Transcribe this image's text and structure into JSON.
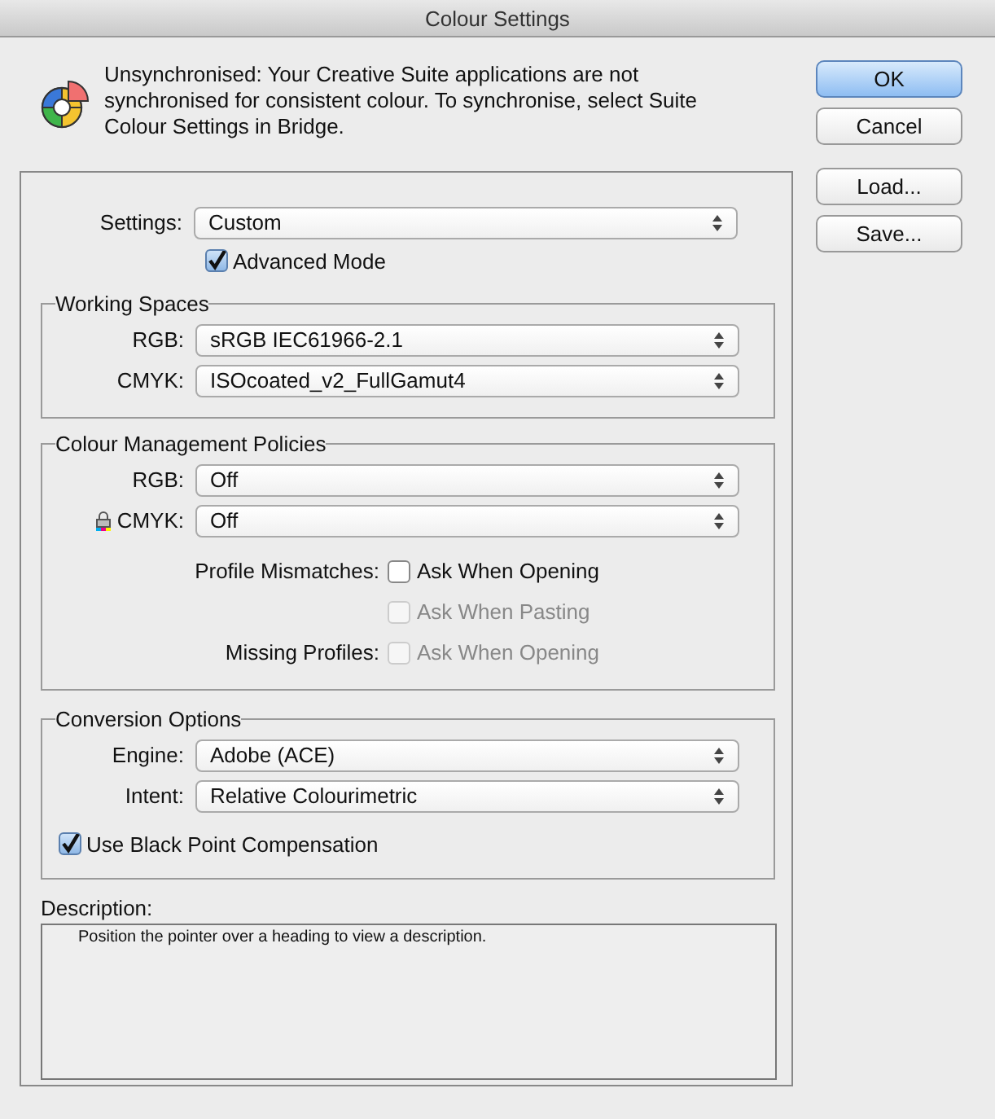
{
  "window": {
    "title": "Colour Settings"
  },
  "message": "Unsynchronised: Your Creative Suite applications are not synchronised for consistent colour. To synchronise, select Suite Colour Settings in Bridge.",
  "settings": {
    "label": "Settings:",
    "value": "Custom"
  },
  "advanced_mode": {
    "label": "Advanced Mode",
    "checked": true
  },
  "working_spaces": {
    "title": "Working Spaces",
    "rows": [
      {
        "label": "RGB:",
        "value": "sRGB IEC61966-2.1",
        "locked": false
      },
      {
        "label": "CMYK:",
        "value": "ISOcoated_v2_FullGamut4",
        "locked": false
      }
    ]
  },
  "policies": {
    "title": "Colour Management Policies",
    "rows": [
      {
        "label": "RGB:",
        "value": "Off",
        "locked": false
      },
      {
        "label": "CMYK:",
        "value": "Off",
        "locked": true
      }
    ],
    "options": [
      {
        "group_label": "Profile Mismatches:",
        "label": "Ask When Opening",
        "checked": false,
        "disabled": false
      },
      {
        "label": "Ask When Pasting",
        "checked": false,
        "disabled": true
      },
      {
        "group_label": "Missing Profiles:",
        "label": "Ask When Opening",
        "checked": false,
        "disabled": true
      }
    ]
  },
  "conversion": {
    "title": "Conversion Options",
    "rows": [
      {
        "label": "Engine:",
        "value": "Adobe (ACE)",
        "locked": false
      },
      {
        "label": "Intent:",
        "value": "Relative Colourimetric",
        "locked": false
      }
    ],
    "black_point": {
      "label": "Use Black Point Compensation",
      "checked": true
    }
  },
  "description": {
    "label": "Description:",
    "text": "Position the pointer over a heading to view a description."
  },
  "buttons": [
    {
      "label": "OK",
      "default": true
    },
    {
      "label": "Cancel",
      "default": false
    },
    {
      "label": "Load...",
      "default": false
    },
    {
      "label": "Save...",
      "default": false
    }
  ]
}
